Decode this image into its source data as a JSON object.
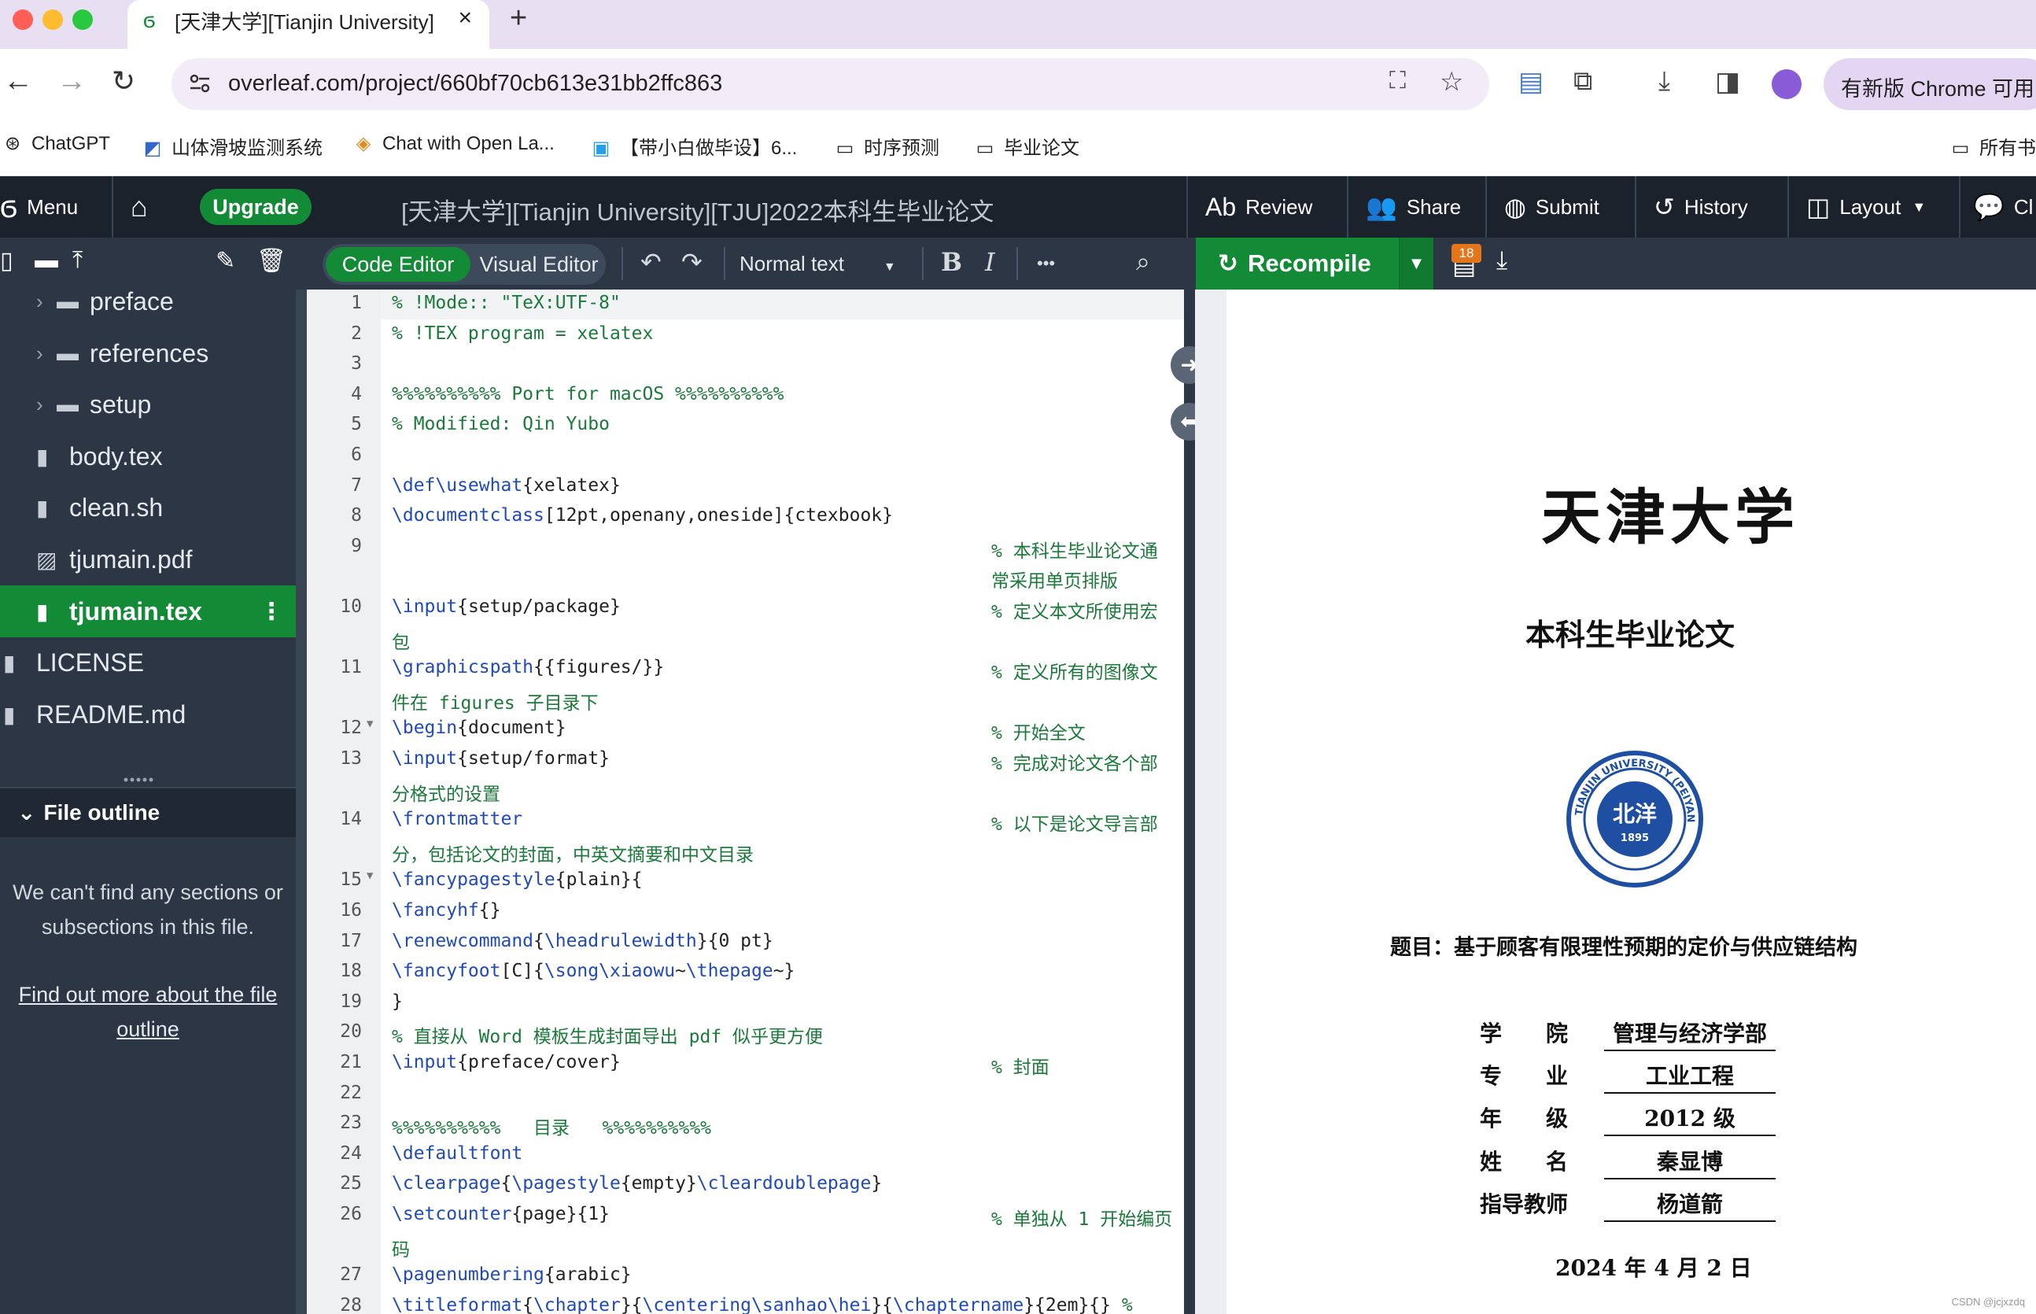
{
  "browser": {
    "tab_title": "[天津大学][Tianjin University][",
    "url": "overleaf.com/project/660bf70cb613e31bb2ffc863",
    "update_label": "有新版 Chrome 可用"
  },
  "bookmarks": [
    {
      "label": "ChatGPT",
      "icon": "chatgpt-icon"
    },
    {
      "label": "山体滑坡监测系统",
      "icon": "app-icon"
    },
    {
      "label": "Chat with Open La...",
      "icon": "chat-icon"
    },
    {
      "label": "【带小白做毕设】6...",
      "icon": "bilibili-icon"
    },
    {
      "label": "时序预测",
      "icon": "folder-icon"
    },
    {
      "label": "毕业论文",
      "icon": "folder-icon"
    },
    {
      "label": "所有书",
      "icon": "folder-icon"
    }
  ],
  "header": {
    "menu_label": "Menu",
    "upgrade_label": "Upgrade",
    "project_title": "[天津大学][Tianjin University][TJU]2022本科生毕业论文",
    "review_label": "Review",
    "share_label": "Share",
    "submit_label": "Submit",
    "history_label": "History",
    "layout_label": "Layout",
    "chat_label": "Cl"
  },
  "toolbar": {
    "code_editor_label": "Code Editor",
    "visual_editor_label": "Visual Editor",
    "text_style": "Normal text",
    "bold_label": "B",
    "italic_label": "I",
    "more_label": "•••",
    "recompile_label": "Recompile",
    "log_badge": "18"
  },
  "file_tree": [
    {
      "name": "preface",
      "type": "folder"
    },
    {
      "name": "references",
      "type": "folder"
    },
    {
      "name": "setup",
      "type": "folder"
    },
    {
      "name": "body.tex",
      "type": "file"
    },
    {
      "name": "clean.sh",
      "type": "file"
    },
    {
      "name": "tjumain.pdf",
      "type": "image"
    },
    {
      "name": "tjumain.tex",
      "type": "file",
      "selected": true
    },
    {
      "name": "LICENSE",
      "type": "file"
    },
    {
      "name": "README.md",
      "type": "file"
    }
  ],
  "outline": {
    "title": "File outline",
    "message": "We can't find any sections or subsections in this file.",
    "link": "Find out more about the file outline"
  },
  "code_lines": [
    {
      "n": "1",
      "code": "% !Mode:: \"TeX:UTF-8\""
    },
    {
      "n": "2",
      "code": "% !TEX program = xelatex"
    },
    {
      "n": "3",
      "code": ""
    },
    {
      "n": "4",
      "code": "%%%%%%%%%% Port for macOS %%%%%%%%%%"
    },
    {
      "n": "5",
      "code": "% Modified: Qin Yubo"
    },
    {
      "n": "6",
      "code": ""
    },
    {
      "n": "7",
      "code": "\\def\\usewhat{xelatex}"
    },
    {
      "n": "8",
      "code": "\\documentclass[12pt,openany,oneside]{ctexbook}"
    },
    {
      "n": "9",
      "code": "",
      "comment": "% 本科生毕业论文通",
      "cont": "常采用单页排版",
      "cont_comment": true
    },
    {
      "n": "10",
      "code": "\\input{setup/package}",
      "comment": "% 定义本文所使用宏",
      "cont": "包",
      "cont_comment": true
    },
    {
      "n": "11",
      "code": "\\graphicspath{{figures/}}",
      "comment": "% 定义所有的图像文",
      "cont": "件在 figures 子目录下",
      "cont_comment": true
    },
    {
      "n": "12",
      "code": "\\begin{document}",
      "comment": "% 开始全文",
      "fold": true
    },
    {
      "n": "13",
      "code": "\\input{setup/format}",
      "comment": "% 完成对论文各个部",
      "cont": "分格式的设置",
      "cont_comment": true
    },
    {
      "n": "14",
      "code": "\\frontmatter",
      "comment": "% 以下是论文导言部",
      "cont": "分，包括论文的封面，中英文摘要和中文目录",
      "cont_comment": true
    },
    {
      "n": "15",
      "code": "\\fancypagestyle{plain}{",
      "fold": true
    },
    {
      "n": "16",
      "code": "\\fancyhf{}"
    },
    {
      "n": "17",
      "code": "\\renewcommand{\\headrulewidth}{0 pt}"
    },
    {
      "n": "18",
      "code": "\\fancyfoot[C]{\\song\\xiaowu~\\thepage~}"
    },
    {
      "n": "19",
      "code": "}"
    },
    {
      "n": "20",
      "code": "% 直接从 Word 模板生成封面导出 pdf 似乎更方便"
    },
    {
      "n": "21",
      "code": "\\input{preface/cover}",
      "comment": "% 封面"
    },
    {
      "n": "22",
      "code": ""
    },
    {
      "n": "23",
      "code": "%%%%%%%%%%   目录   %%%%%%%%%%"
    },
    {
      "n": "24",
      "code": "\\defaultfont"
    },
    {
      "n": "25",
      "code": "\\clearpage{\\pagestyle{empty}\\cleardoublepage}"
    },
    {
      "n": "26",
      "code": "\\setcounter{page}{1}",
      "comment": "% 单独从 1 开始编页",
      "cont": "码",
      "cont_comment": true
    },
    {
      "n": "27",
      "code": "\\pagenumbering{arabic}"
    },
    {
      "n": "28",
      "code": "\\titleformat{\\chapter}{\\centering\\sanhao\\hei}{\\chaptername}{2em}{} %"
    }
  ],
  "pdf": {
    "university": "天津大学",
    "thesis_type": "本科生毕业论文",
    "seal_text": "TIANJIN UNIVERSITY (PEIYANG UNIVERSITY)",
    "seal_year": "1895",
    "seal_center": "北洋",
    "title": "题目：基于顾客有限理性预期的定价与供应链结构",
    "info": [
      {
        "label": "学　　院",
        "value": "管理与经济学部"
      },
      {
        "label": "专　　业",
        "value": "工业工程"
      },
      {
        "label": "年　　级",
        "value": "2012 级"
      },
      {
        "label": "姓　　名",
        "value": "秦显博"
      },
      {
        "label": "指导教师",
        "value": "杨道箭"
      }
    ],
    "date": "2024 年 4 月 2 日",
    "watermark": "CSDN @jcjxzdq"
  },
  "colors": {
    "overleaf_green": "#138a36",
    "header_dark": "#1b222c",
    "panel_dark": "#2c3645"
  }
}
